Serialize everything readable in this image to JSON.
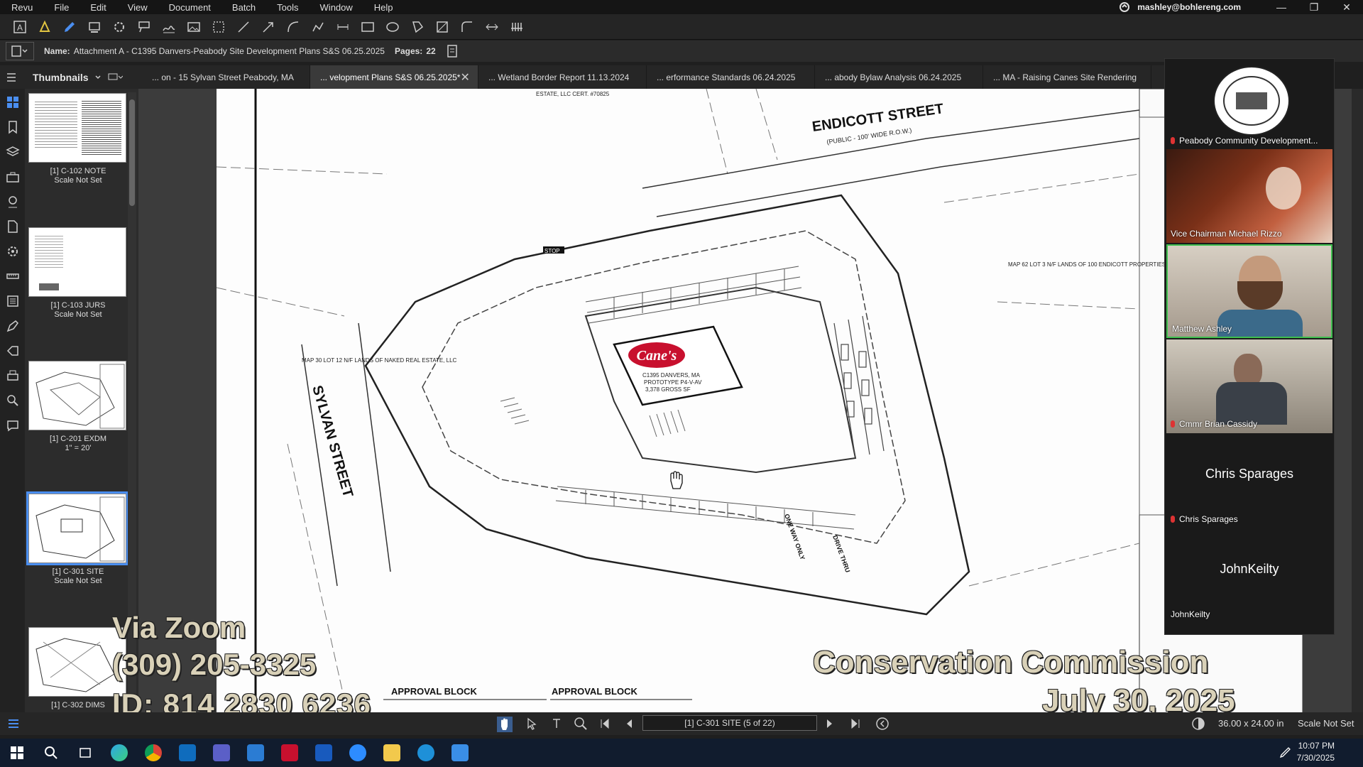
{
  "menu": [
    "Revu",
    "File",
    "Edit",
    "View",
    "Document",
    "Batch",
    "Tools",
    "Window",
    "Help"
  ],
  "user_email": "mashley@bohlereng.com",
  "window_controls": {
    "minimize": "—",
    "maximize": "❐",
    "close": "✕"
  },
  "props": {
    "name_label": "Name:",
    "name_value": "Attachment A - C1395 Danvers-Peabody Site Development Plans S&S 06.25.2025",
    "pages_label": "Pages:",
    "pages_value": "22"
  },
  "panel_title": "Thumbnails",
  "tabs": [
    {
      "label": "... on - 15 Sylvan Street Peabody, MA",
      "active": false
    },
    {
      "label": "... velopment Plans S&S 06.25.2025*",
      "active": true
    },
    {
      "label": "... Wetland Border Report 11.13.2024",
      "active": false
    },
    {
      "label": "... erformance Standards 06.24.2025",
      "active": false
    },
    {
      "label": "... abody Bylaw Analysis 06.24.2025",
      "active": false
    },
    {
      "label": "... MA - Raising Canes Site Rendering",
      "active": false
    }
  ],
  "thumbnails": [
    {
      "title": "[1] C-102 NOTE",
      "scale": "Scale Not Set",
      "selected": false
    },
    {
      "title": "[1] C-103 JURS",
      "scale": "Scale Not Set",
      "selected": false
    },
    {
      "title": "[1] C-201 EXDM",
      "scale": "1\" = 20'",
      "selected": false
    },
    {
      "title": "[1] C-301 SITE",
      "scale": "Scale Not Set",
      "selected": true
    },
    {
      "title": "[1] C-302 DIMS",
      "scale": "",
      "selected": false
    }
  ],
  "plan_labels": {
    "endicott": "ENDICOTT STREET",
    "endicott_sub": "(PUBLIC - 100' WIDE R.O.W.)",
    "sylvan": "SYLVAN STREET",
    "canes": "Cane's",
    "bldg1": "C1395 DANVERS, MA",
    "bldg2": "PROTOTYPE P4-V-AV",
    "bldg3": "3,378 GROSS SF",
    "map30": "MAP 30 LOT 12 N/F LANDS OF NAKED REAL ESTATE, LLC",
    "map62": "MAP 62 LOT 3 N/F LANDS OF 100 ENDICOTT PROPERTIES, LLC",
    "approval1": "APPROVAL BLOCK",
    "approval2": "APPROVAL BLOCK",
    "estate": "ESTATE, LLC CERT. #70825",
    "drive_thru": "DRIVE THRU",
    "one_way": "ONE WAY ONLY",
    "stop": "STOP"
  },
  "participants": [
    {
      "name": "Peabody Community Development...",
      "muted": true,
      "type": "logo"
    },
    {
      "name": "Vice Chairman Michael Rizzo",
      "muted": false,
      "type": "video"
    },
    {
      "name": "Matthew Ashley",
      "muted": false,
      "type": "video",
      "active": true
    },
    {
      "name": "Cmmr Brian Cassidy",
      "muted": true,
      "type": "video"
    },
    {
      "name": "Chris Sparages",
      "muted": true,
      "type": "name",
      "big": "Chris Sparages"
    },
    {
      "name": "JohnKeilty",
      "muted": false,
      "type": "name",
      "big": "JohnKeilty"
    }
  ],
  "overlay": {
    "via_zoom": "Via Zoom",
    "phone": "(309) 205-3325",
    "meeting_id": "ID:  814 2830 6236",
    "commission": "Conservation Commission",
    "date": "July 30, 2025"
  },
  "bottom": {
    "page_indicator": "[1] C-301 SITE (5 of 22)",
    "dimensions": "36.00 x 24.00 in",
    "scale": "Scale Not Set"
  },
  "clock": {
    "time": "10:07 PM",
    "date": "7/30/2025"
  },
  "colors": {
    "accent": "#4a8ef0",
    "canes_red": "#c8102e",
    "speaker_border": "#3fbf4f",
    "taskbar": "#111c2e"
  }
}
